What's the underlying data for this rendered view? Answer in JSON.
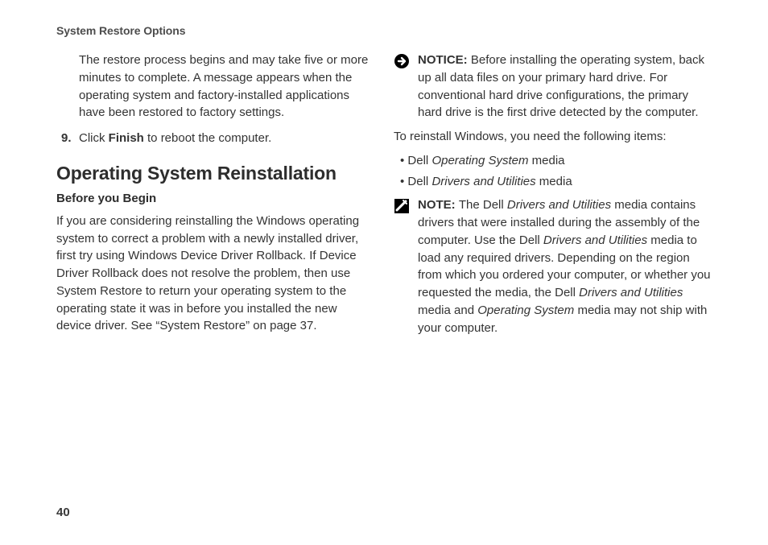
{
  "header": "System Restore Options",
  "page_number": "40",
  "left": {
    "restore_para": "The restore process begins and may take five or more minutes to complete. A message appears when the operating system and factory-installed applications have been restored to factory settings.",
    "step9_num": "9.",
    "step9_prefix": "Click ",
    "step9_bold": "Finish",
    "step9_suffix": " to reboot the computer.",
    "h2": "Operating System Reinstallation",
    "sub": "Before you Begin",
    "before_para": "If you are considering reinstalling the Windows operating system to correct a problem with a newly installed driver, first try using Windows Device Driver Rollback. If Device Driver Rollback does not resolve the problem, then use System Restore to return your operating system to the operating state it was in before you installed the new device driver. See “System Restore” on page 37."
  },
  "right": {
    "notice_label": "NOTICE: ",
    "notice_text": "Before installing the operating system, back up all data files on your primary hard drive. For conventional hard drive configurations, the primary hard drive is the first drive detected by the computer.",
    "reinstall_intro": "To reinstall Windows, you need the following items:",
    "bullet1_pre": "Dell ",
    "bullet1_it": "Operating System",
    "bullet1_post": " media",
    "bullet2_pre": "Dell ",
    "bullet2_it": "Drivers and Utilities",
    "bullet2_post": " media",
    "note_label": "NOTE: ",
    "note_1": "The Dell ",
    "note_it1": "Drivers and Utilities",
    "note_2": " media contains drivers that were installed during the assembly of the computer. Use the Dell ",
    "note_it2": "Drivers and Utilities",
    "note_3": " media to load any required drivers. Depending on the region from which you ordered your computer, or whether you requested the media, the Dell ",
    "note_it3": "Drivers and Utilities",
    "note_4": " media and ",
    "note_it4": "Operating System",
    "note_5": " media may not ship with your computer."
  }
}
